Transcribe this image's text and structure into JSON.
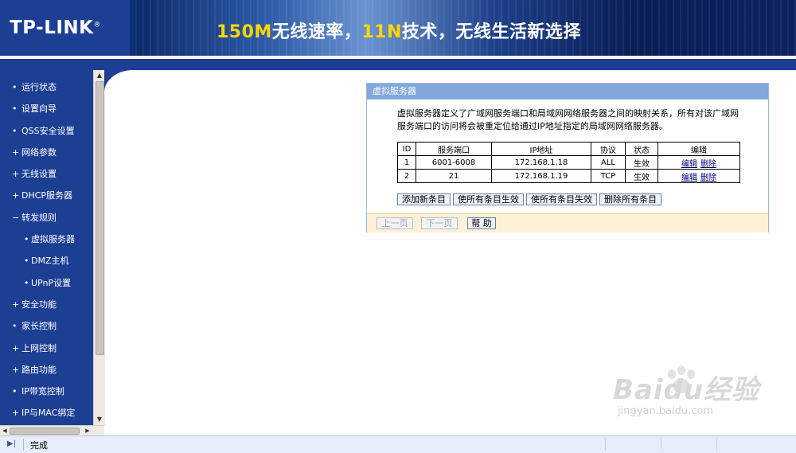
{
  "header": {
    "logo": "TP-LINK",
    "slogan_parts": [
      "150M",
      "无线速率，",
      "11N",
      "技术，无线生活新选择"
    ]
  },
  "sidebar": {
    "items": [
      {
        "label": "运行状态",
        "bullet": "•"
      },
      {
        "label": "设置向导",
        "bullet": "•"
      },
      {
        "label": "QSS安全设置",
        "bullet": "•"
      },
      {
        "label": "网络参数",
        "bullet": "+"
      },
      {
        "label": "无线设置",
        "bullet": "+"
      },
      {
        "label": "DHCP服务器",
        "bullet": "+"
      },
      {
        "label": "转发规则",
        "bullet": "−"
      },
      {
        "label": "虚拟服务器",
        "bullet": "•"
      },
      {
        "label": "DMZ主机",
        "bullet": "•"
      },
      {
        "label": "UPnP设置",
        "bullet": "•"
      },
      {
        "label": "安全功能",
        "bullet": "+"
      },
      {
        "label": "家长控制",
        "bullet": "•"
      },
      {
        "label": "上网控制",
        "bullet": "+"
      },
      {
        "label": "路由功能",
        "bullet": "+"
      },
      {
        "label": "IP带宽控制",
        "bullet": "•"
      },
      {
        "label": "IP与MAC绑定",
        "bullet": "+"
      }
    ]
  },
  "panel": {
    "title": "虚拟服务器",
    "desc_line1": "虚拟服务器定义了广域网服务端口和局域网网络服务器之间的映射关系，所有对该广域网",
    "desc_line2": "服务端口的访问将会被重定位给通过IP地址指定的局域网网络服务器。",
    "table": {
      "headers": [
        "ID",
        "服务端口",
        "IP地址",
        "协议",
        "状态",
        "编辑"
      ],
      "rows": [
        {
          "id": "1",
          "port": "6001-6008",
          "ip": "172.168.1.18",
          "protocol": "ALL",
          "status": "生效",
          "edit": "编辑",
          "delete": "删除"
        },
        {
          "id": "2",
          "port": "21",
          "ip": "172.168.1.19",
          "protocol": "TCP",
          "status": "生效",
          "edit": "编辑",
          "delete": "删除"
        }
      ]
    },
    "buttons": {
      "add": "添加新条目",
      "enable_all": "使所有条目生效",
      "disable_all": "使所有条目失效",
      "delete_all": "删除所有条目"
    },
    "footer": {
      "prev": "上一页",
      "next": "下一页",
      "help": "帮 助"
    }
  },
  "watermark": {
    "main": "Baidu经验",
    "sub": "jingyan.baidu.com"
  },
  "statusbar": {
    "text": "完成"
  },
  "colors": {
    "sidebar_bg": "#1c3f94",
    "panel_title_bg": "#82a8dc",
    "footer_bg": "#fff1d6"
  }
}
